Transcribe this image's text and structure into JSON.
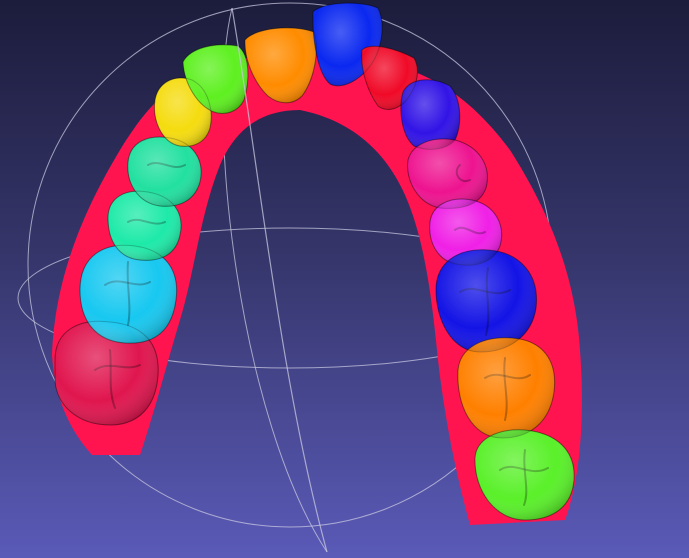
{
  "viewer": {
    "background_top": "#1c1c3c",
    "background_bottom": "#5a5ab8",
    "trackball_color": "#c8c8e0"
  },
  "model": {
    "gum_color": "#ff1450",
    "teeth": [
      {
        "id": "left-molar-2",
        "color": "#e0164f"
      },
      {
        "id": "left-molar-1",
        "color": "#18c8f0"
      },
      {
        "id": "left-premolar-2",
        "color": "#1eeaa8"
      },
      {
        "id": "left-premolar-1",
        "color": "#22e0a0"
      },
      {
        "id": "left-canine",
        "color": "#f5dc10"
      },
      {
        "id": "left-lateral-incisor",
        "color": "#5ef020"
      },
      {
        "id": "left-central-incisor",
        "color": "#ff8c00"
      },
      {
        "id": "right-central-incisor",
        "color": "#0a28f0"
      },
      {
        "id": "right-lateral-incisor",
        "color": "#f00a28"
      },
      {
        "id": "right-canine",
        "color": "#3214e6"
      },
      {
        "id": "right-premolar-1",
        "color": "#ee1490"
      },
      {
        "id": "right-premolar-2",
        "color": "#f020e6"
      },
      {
        "id": "right-molar-1",
        "color": "#1414e6"
      },
      {
        "id": "right-molar-2",
        "color": "#ff8000"
      },
      {
        "id": "right-molar-3",
        "color": "#5af02a"
      }
    ]
  }
}
